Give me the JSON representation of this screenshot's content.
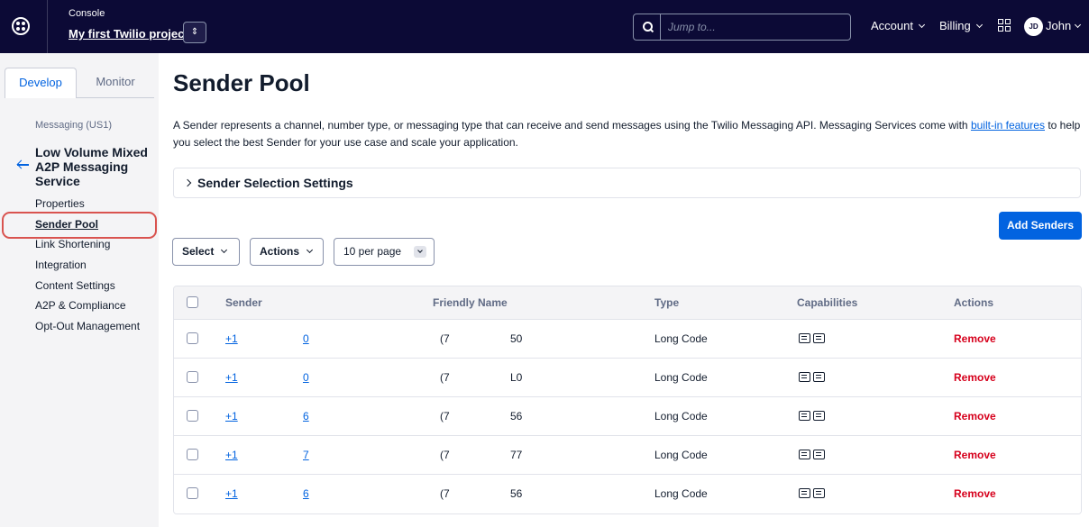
{
  "topbar": {
    "console_label": "Console",
    "project_name": "My first Twilio project",
    "search_placeholder": "Jump to...",
    "account_label": "Account",
    "billing_label": "Billing",
    "user_initials": "JD",
    "user_name": "John"
  },
  "sidebar": {
    "tabs": [
      {
        "label": "Develop",
        "active": true
      },
      {
        "label": "Monitor",
        "active": false
      }
    ],
    "breadcrumb": "Messaging (US1)",
    "service_title": "Low Volume Mixed A2P Messaging Service",
    "nav_items": [
      {
        "label": "Properties"
      },
      {
        "label": "Sender Pool",
        "current": true
      },
      {
        "label": "Link Shortening"
      },
      {
        "label": "Integration"
      },
      {
        "label": "Content Settings"
      },
      {
        "label": "A2P & Compliance"
      },
      {
        "label": "Opt-Out Management"
      }
    ]
  },
  "main": {
    "title": "Sender Pool",
    "description_part1": "A Sender represents a channel, number type, or messaging type that can receive and send messages using the Twilio Messaging API. Messaging Services come with ",
    "description_link": "built-in features",
    "description_part2": " to help you select the best Sender for your use case and scale your application.",
    "disclosure_label": "Sender Selection Settings",
    "add_button": "Add Senders",
    "select_label": "Select",
    "actions_label": "Actions",
    "per_page_label": "10 per page"
  },
  "table": {
    "headers": {
      "sender": "Sender",
      "friendly_name": "Friendly Name",
      "type": "Type",
      "capabilities": "Capabilities",
      "actions": "Actions"
    },
    "rows": [
      {
        "sender_prefix": "+1",
        "sender_suffix": "0",
        "friendly_prefix": "(7",
        "friendly_suffix": "50",
        "type": "Long Code",
        "action": "Remove"
      },
      {
        "sender_prefix": "+1",
        "sender_suffix": "0",
        "friendly_prefix": "(7",
        "friendly_suffix": "L0",
        "type": "Long Code",
        "action": "Remove"
      },
      {
        "sender_prefix": "+1",
        "sender_suffix": "6",
        "friendly_prefix": "(7",
        "friendly_suffix": "56",
        "type": "Long Code",
        "action": "Remove"
      },
      {
        "sender_prefix": "+1",
        "sender_suffix": "7",
        "friendly_prefix": "(7",
        "friendly_suffix": "77",
        "type": "Long Code",
        "action": "Remove"
      },
      {
        "sender_prefix": "+1",
        "sender_suffix": "6",
        "friendly_prefix": "(7",
        "friendly_suffix": "56",
        "type": "Long Code",
        "action": "Remove"
      }
    ]
  },
  "colors": {
    "topbar_bg": "#0c0a36",
    "accent_blue": "#0263e0",
    "remove_red": "#d6001c",
    "highlight_red": "#d9534f"
  }
}
